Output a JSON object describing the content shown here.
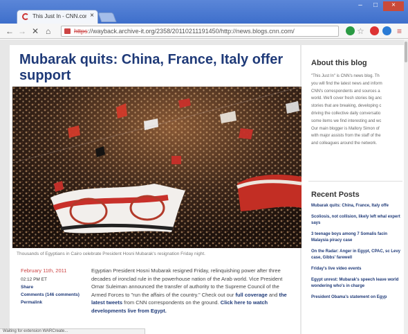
{
  "browser": {
    "tab_title": "This Just In - CNN.com B",
    "tab_close": "×",
    "window_buttons": [
      "–",
      "□",
      "×"
    ],
    "url_scheme": "https",
    "url_rest": "://wayback.archive-it.org/2358/20110211191450/http://news.blogs.cnn.com/",
    "status_text": "Waiting for extension WARCreate..."
  },
  "article": {
    "headline": "Mubarak quits: China, France, Italy offer support",
    "caption": "Thousands of Egyptians in Cairo celebrate President Hosni Mubarak's resignation Friday night.",
    "date": "February 11th, 2011",
    "time": "02:12 PM ET",
    "share": "Share",
    "comments": "Comments (146 comments)",
    "permalink": "Permalink",
    "body_1": "Egyptian President Hosni Mubarak resigned Friday, relinquishing power after three decades of ironclad rule in the powerhouse nation of the Arab world. Vice President Omar Suleiman announced the transfer of authority to the Supreme Council of the Armed Forces to \"run the affairs of the country.\" Check out our ",
    "body_link_1": "full coverage",
    "body_2": " and ",
    "body_link_2": "the latest tweets",
    "body_3": " from CNN correspondents on the ground. ",
    "body_link_3": "Click here to watch developments live from Egypt."
  },
  "sidebar": {
    "about_title": "About this blog",
    "about_lines": [
      "\"This Just In\" is CNN's news blog. Th",
      "you will find the latest news and inform",
      "CNN's correspondents and sources a",
      "world. We'll cover fresh stories big anc",
      "stories that are breaking, developing c",
      "driving the collective daily conversatio",
      "some items we find interesting and wc",
      "Our main blogger is Mallory Simon of",
      "with major assists from the staff of the",
      "and colleagues around the network."
    ],
    "recent_title": "Recent Posts",
    "recent_posts": [
      "Mubarak quits: China, France, Italy offe",
      "Scoliosis, not collision, likely left whal expert says",
      "3 teenage boys among 7 Somalis facin Malaysia piracy case",
      "On the Radar: Anger in Egypt, CPAC, sc Levy case, Gibbs' farewell",
      "Friday's live video events",
      "Egypt unrest: Mubarak's speech leave world wondering who's in charge",
      "President Obama's statement on Egyp"
    ]
  },
  "colors": {
    "titlebar": "#4a79d2",
    "headline": "#1f3a78",
    "date": "#cc4444"
  }
}
